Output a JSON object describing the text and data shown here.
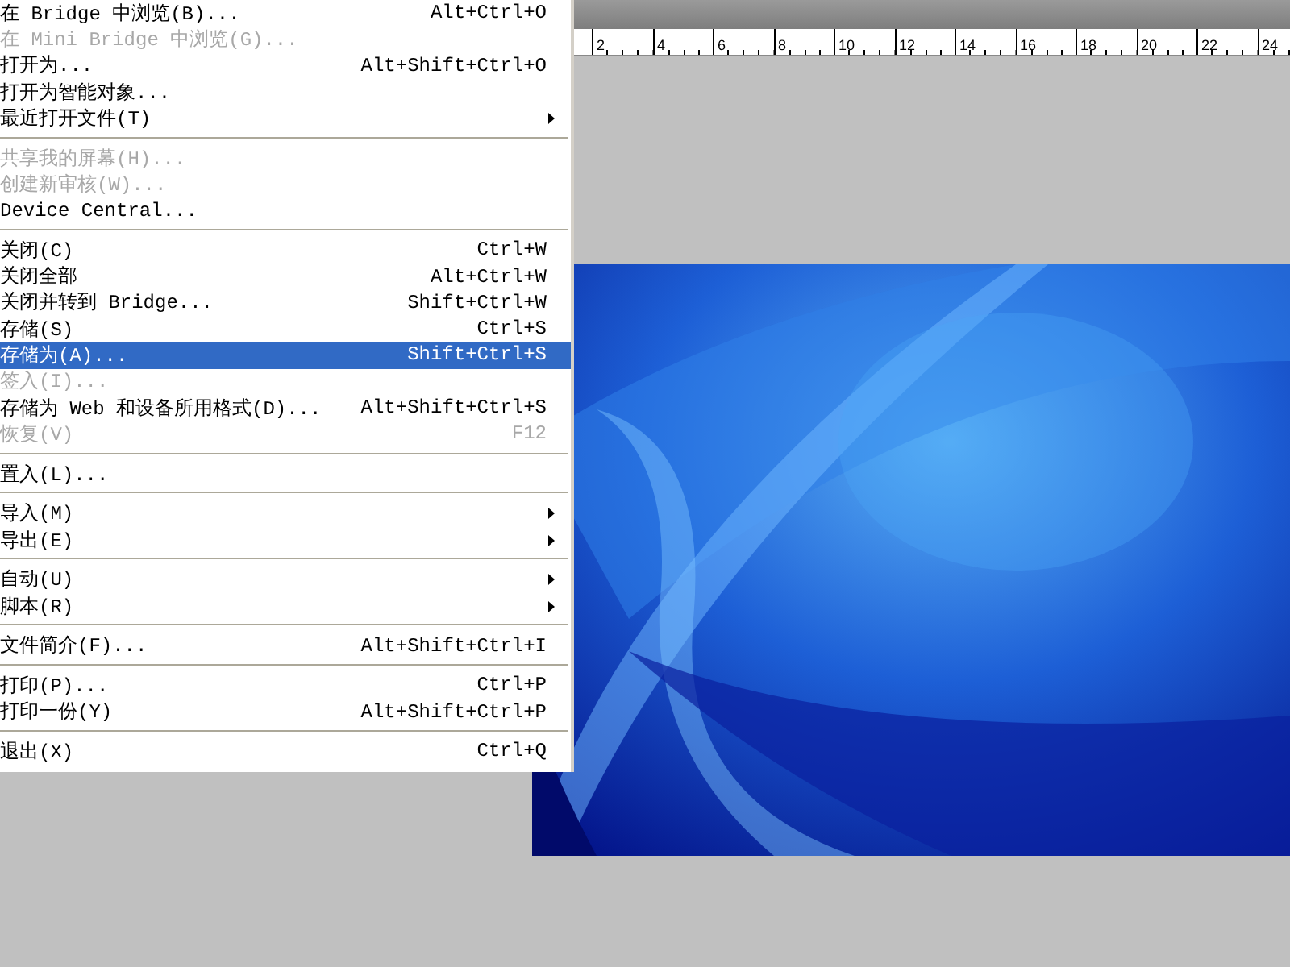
{
  "menu": {
    "items": [
      {
        "kind": "item",
        "label": "在 Bridge 中浏览(B)...",
        "shortcut": "Alt+Ctrl+O",
        "disabled": false,
        "selected": false
      },
      {
        "kind": "item",
        "label": "在 Mini Bridge 中浏览(G)...",
        "disabled": true,
        "selected": false
      },
      {
        "kind": "item",
        "label": "打开为...",
        "shortcut": "Alt+Shift+Ctrl+O",
        "disabled": false,
        "selected": false
      },
      {
        "kind": "item",
        "label": "打开为智能对象...",
        "disabled": false,
        "selected": false
      },
      {
        "kind": "submenu",
        "label": "最近打开文件(T)",
        "disabled": false,
        "selected": false
      },
      {
        "kind": "separator"
      },
      {
        "kind": "item",
        "label": "共享我的屏幕(H)...",
        "disabled": true,
        "selected": false
      },
      {
        "kind": "item",
        "label": "创建新审核(W)...",
        "disabled": true,
        "selected": false
      },
      {
        "kind": "item",
        "label": "Device Central...",
        "disabled": false,
        "selected": false
      },
      {
        "kind": "separator"
      },
      {
        "kind": "item",
        "label": "关闭(C)",
        "shortcut": "Ctrl+W",
        "disabled": false,
        "selected": false
      },
      {
        "kind": "item",
        "label": "关闭全部",
        "shortcut": "Alt+Ctrl+W",
        "disabled": false,
        "selected": false
      },
      {
        "kind": "item",
        "label": "关闭并转到 Bridge...",
        "shortcut": "Shift+Ctrl+W",
        "disabled": false,
        "selected": false
      },
      {
        "kind": "item",
        "label": "存储(S)",
        "shortcut": "Ctrl+S",
        "disabled": false,
        "selected": false
      },
      {
        "kind": "item",
        "label": "存储为(A)...",
        "shortcut": "Shift+Ctrl+S",
        "disabled": false,
        "selected": true
      },
      {
        "kind": "item",
        "label": "签入(I)...",
        "disabled": true,
        "selected": false
      },
      {
        "kind": "item",
        "label": "存储为 Web 和设备所用格式(D)...",
        "shortcut": "Alt+Shift+Ctrl+S",
        "disabled": false,
        "selected": false
      },
      {
        "kind": "item",
        "label": "恢复(V)",
        "shortcut": "F12",
        "disabled": true,
        "selected": false
      },
      {
        "kind": "separator"
      },
      {
        "kind": "item",
        "label": "置入(L)...",
        "disabled": false,
        "selected": false
      },
      {
        "kind": "separator"
      },
      {
        "kind": "submenu",
        "label": "导入(M)",
        "disabled": false,
        "selected": false
      },
      {
        "kind": "submenu",
        "label": "导出(E)",
        "disabled": false,
        "selected": false
      },
      {
        "kind": "separator"
      },
      {
        "kind": "submenu",
        "label": "自动(U)",
        "disabled": false,
        "selected": false
      },
      {
        "kind": "submenu",
        "label": "脚本(R)",
        "disabled": false,
        "selected": false
      },
      {
        "kind": "separator"
      },
      {
        "kind": "item",
        "label": "文件简介(F)...",
        "shortcut": "Alt+Shift+Ctrl+I",
        "disabled": false,
        "selected": false
      },
      {
        "kind": "separator"
      },
      {
        "kind": "item",
        "label": "打印(P)...",
        "shortcut": "Ctrl+P",
        "disabled": false,
        "selected": false
      },
      {
        "kind": "item",
        "label": "打印一份(Y)",
        "shortcut": "Alt+Shift+Ctrl+P",
        "disabled": false,
        "selected": false
      },
      {
        "kind": "separator"
      },
      {
        "kind": "item",
        "label": "退出(X)",
        "shortcut": "Ctrl+Q",
        "disabled": false,
        "selected": false
      }
    ]
  },
  "ruler": {
    "labels": [
      "2",
      "4",
      "6",
      "8",
      "10",
      "12",
      "14",
      "16",
      "18",
      "20",
      "22",
      "24"
    ]
  }
}
